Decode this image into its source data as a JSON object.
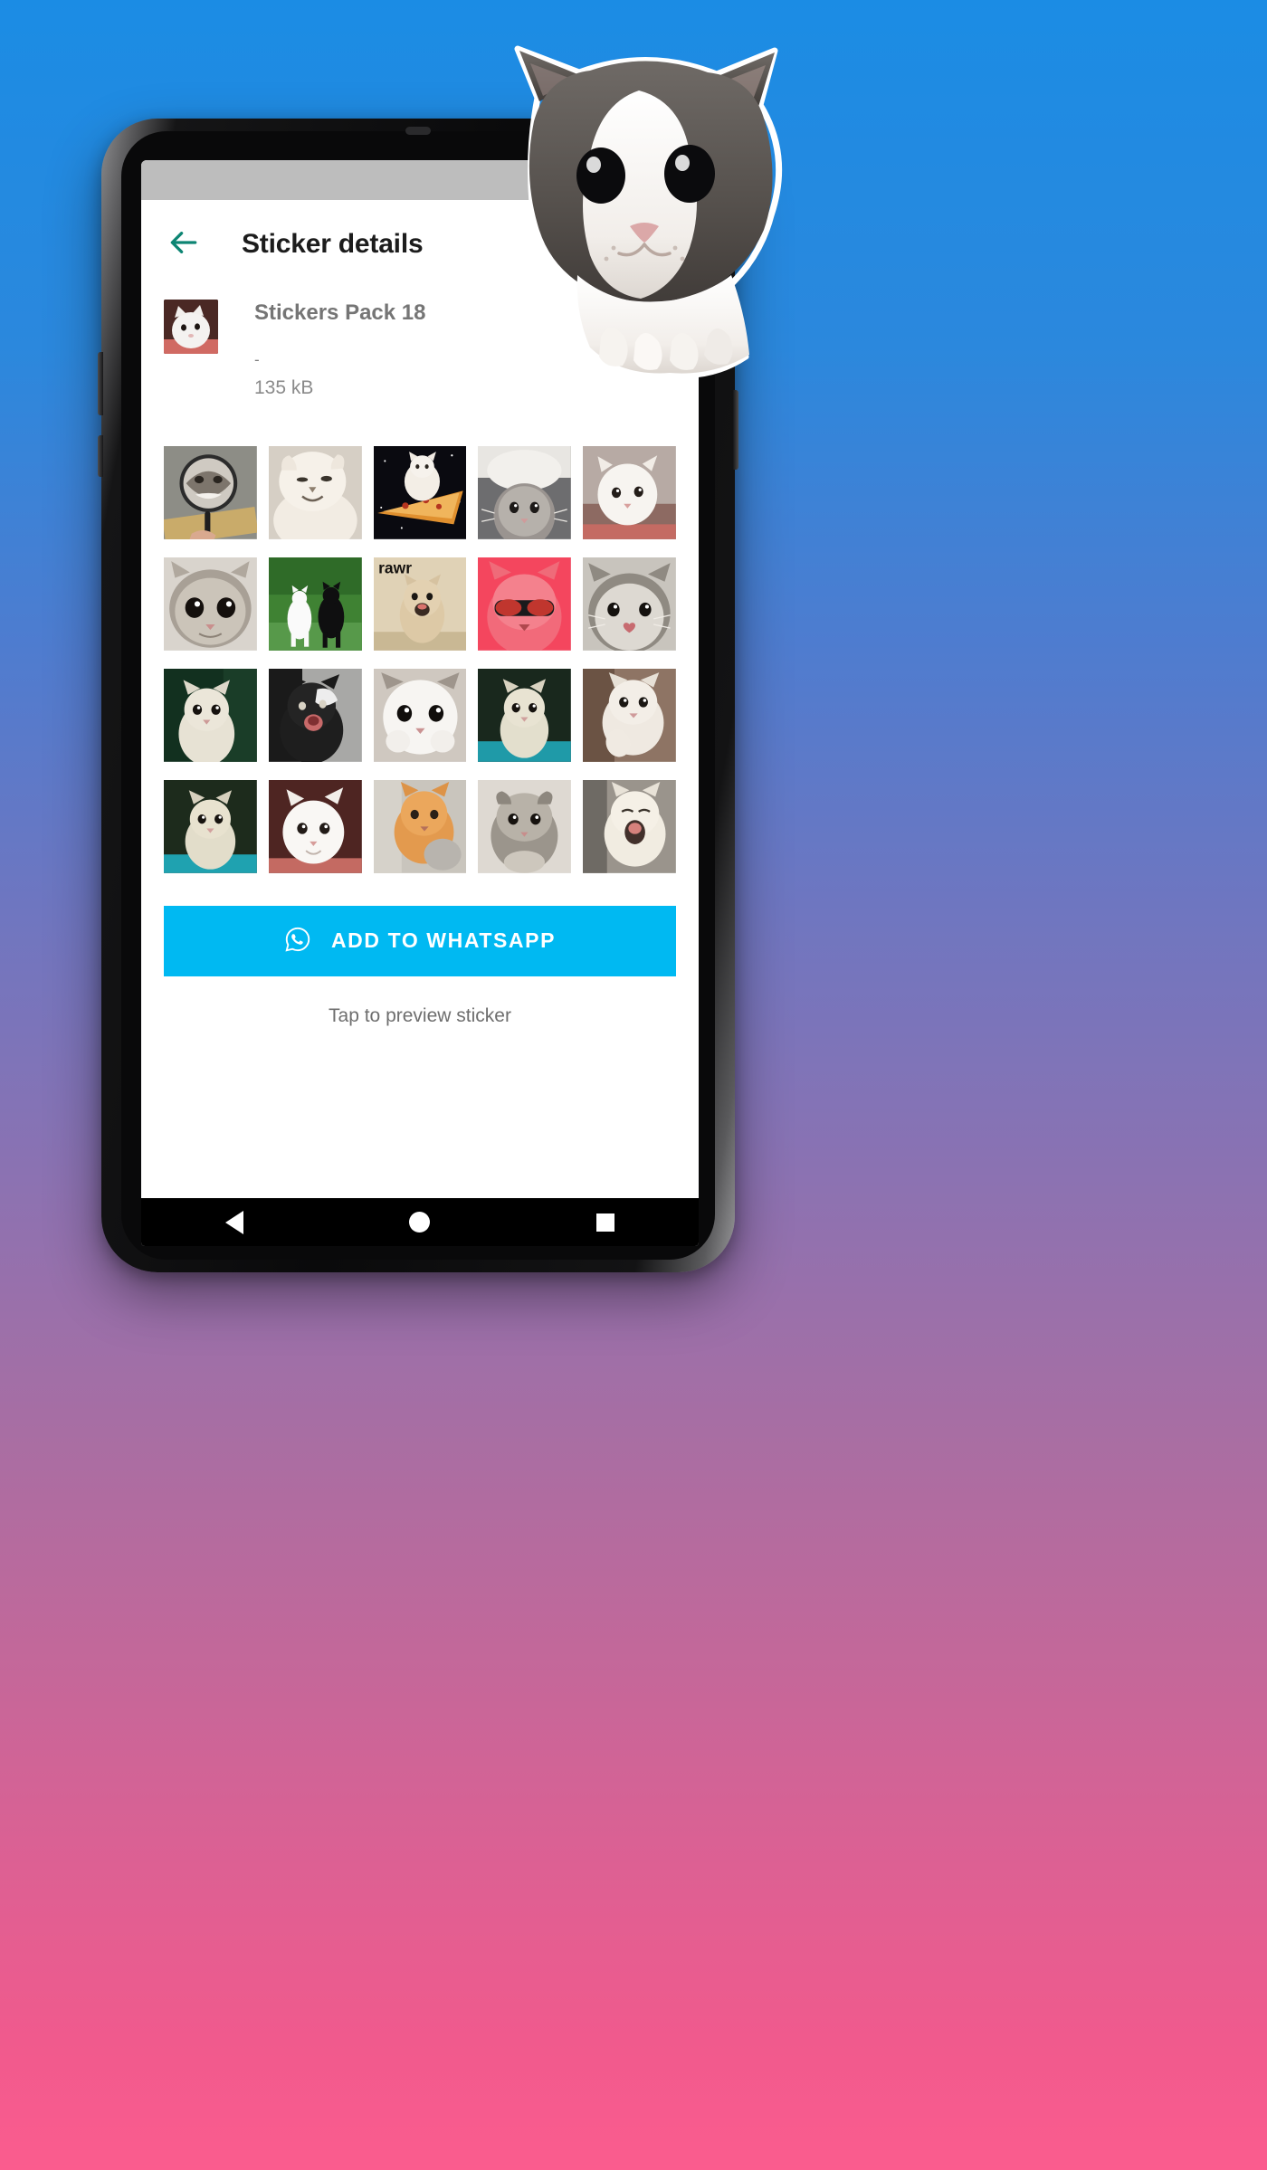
{
  "background": {
    "gradient_from": "#1b8ce4",
    "gradient_to": "#fb5c8e"
  },
  "device": {
    "platform": "android",
    "status_bar_color": "#bdbdbd",
    "nav_bar_color": "#000000"
  },
  "appbar": {
    "title": "Sticker details",
    "back_icon": "arrow-left-icon",
    "back_icon_color": "#0d8573"
  },
  "pack": {
    "name": "Stickers Pack 18",
    "publisher": "-",
    "size": "135 kB",
    "thumbnail_alt": "white-kitten-thumbnail"
  },
  "stickers": [
    {
      "id": 1,
      "alt": "cat-face-in-hand-mirror"
    },
    {
      "id": 2,
      "alt": "white-cat-smug-squint"
    },
    {
      "id": 3,
      "alt": "white-cat-sitting-on-pizza"
    },
    {
      "id": 4,
      "alt": "grey-cat-wearing-white-hat"
    },
    {
      "id": 5,
      "alt": "white-kitten-on-red-blanket"
    },
    {
      "id": 6,
      "alt": "grey-kitten-big-eyes"
    },
    {
      "id": 7,
      "alt": "white-and-black-cats-on-grass"
    },
    {
      "id": 8,
      "alt": "rawr-meme-cat"
    },
    {
      "id": 9,
      "alt": "pink-cat-with-sunglasses"
    },
    {
      "id": 10,
      "alt": "grey-white-cat-heart-nose"
    },
    {
      "id": 11,
      "alt": "teary-white-cat-green-bg"
    },
    {
      "id": 12,
      "alt": "black-white-cat-mouth-open"
    },
    {
      "id": 13,
      "alt": "white-cat-paws-on-face"
    },
    {
      "id": 14,
      "alt": "white-kitten-teal-floor"
    },
    {
      "id": 15,
      "alt": "white-cat-raising-paw"
    },
    {
      "id": 16,
      "alt": "kitten-on-teal-surface"
    },
    {
      "id": 17,
      "alt": "white-kitten-dark-red-bg"
    },
    {
      "id": 18,
      "alt": "orange-cat-hugging-toy"
    },
    {
      "id": 19,
      "alt": "grey-scottish-fold-kitten"
    },
    {
      "id": 20,
      "alt": "cream-cat-yawning"
    }
  ],
  "cta": {
    "label": "ADD TO WHATSAPP",
    "icon": "whatsapp-icon",
    "background_color": "#00b9f2",
    "text_color": "#ffffff"
  },
  "hint": {
    "text": "Tap to preview sticker"
  },
  "nav_bar": {
    "back_label": "Back",
    "home_label": "Home",
    "recents_label": "Recents"
  },
  "decoration": {
    "cat_overlay_alt": "cutout-grey-white-cat-peeking-over-phone"
  }
}
